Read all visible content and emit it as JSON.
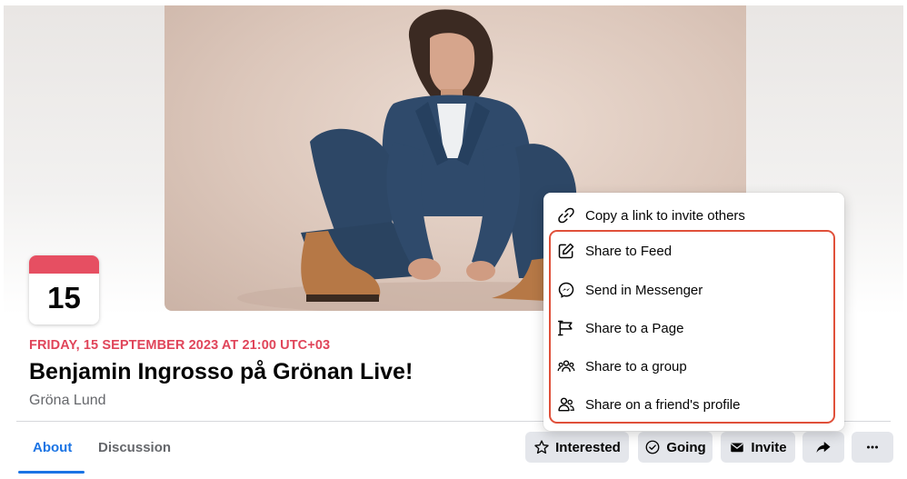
{
  "event": {
    "badge_day": "15",
    "date_line": "FRIDAY, 15 SEPTEMBER 2023 AT 21:00 UTC+03",
    "title": "Benjamin Ingrosso på Grönan Live!",
    "location": "Gröna Lund"
  },
  "tabs": [
    {
      "label": "About",
      "active": true
    },
    {
      "label": "Discussion",
      "active": false
    }
  ],
  "actions": {
    "interested": "Interested",
    "going": "Going",
    "invite": "Invite"
  },
  "share_menu": {
    "items": [
      {
        "label": "Copy a link to invite others",
        "icon": "link-icon"
      },
      {
        "label": "Share to Feed",
        "icon": "edit-icon"
      },
      {
        "label": "Send in Messenger",
        "icon": "messenger-icon"
      },
      {
        "label": "Share to a Page",
        "icon": "flag-icon"
      },
      {
        "label": "Share to a group",
        "icon": "group-icon"
      },
      {
        "label": "Share on a friend's profile",
        "icon": "friend-icon"
      }
    ]
  },
  "colors": {
    "accent": "#1b74e4",
    "date_red": "#e0455a",
    "highlight": "#e0503a",
    "button_bg": "#e4e6eb"
  }
}
